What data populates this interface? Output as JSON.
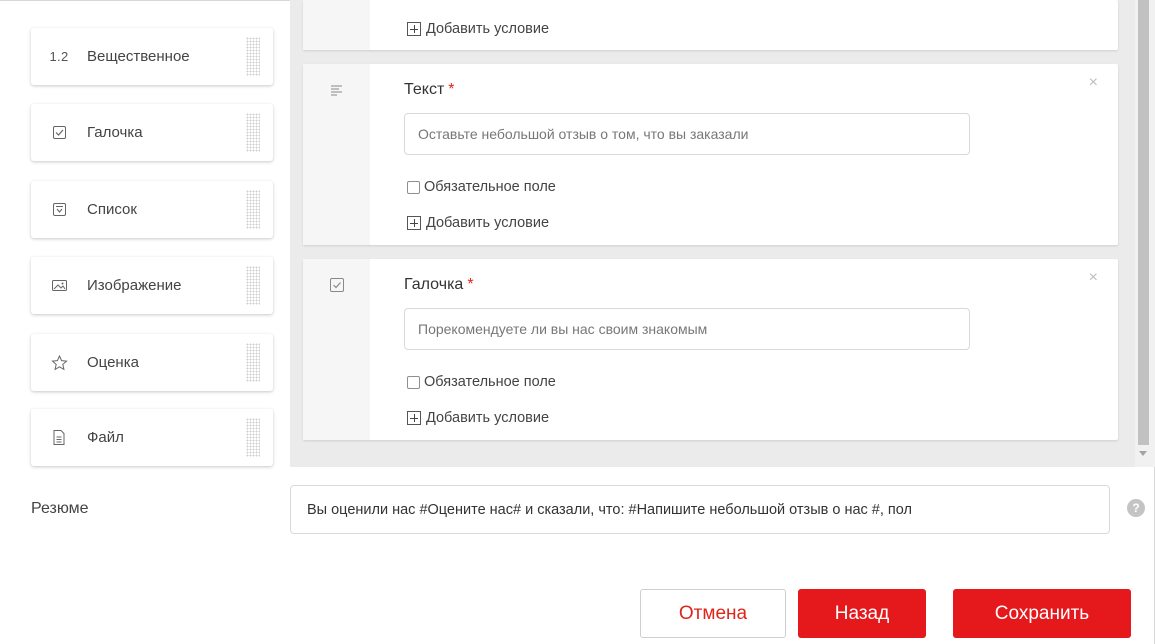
{
  "palette": {
    "items": [
      {
        "label": "Вещественное",
        "icon": "decimal-number-icon",
        "icon_text": "1.2"
      },
      {
        "label": "Галочка",
        "icon": "checkbox-icon"
      },
      {
        "label": "Список",
        "icon": "dropdown-list-icon"
      },
      {
        "label": "Изображение",
        "icon": "image-icon"
      },
      {
        "label": "Оценка",
        "icon": "star-icon"
      },
      {
        "label": "Файл",
        "icon": "file-icon"
      }
    ]
  },
  "form": {
    "previous_card": {
      "add_condition_label": "Добавить условие"
    },
    "cards": [
      {
        "icon": "text-lines-icon",
        "title": "Текст",
        "required_mark": "*",
        "input_placeholder": "Оставьте небольшой отзыв о том, что вы заказали",
        "required_checkbox_label": "Обязательное поле",
        "add_condition_label": "Добавить условие",
        "close_glyph": "×"
      },
      {
        "icon": "checkbox-icon",
        "title": "Галочка",
        "required_mark": "*",
        "input_placeholder": "Порекомендуете ли вы нас своим знакомым",
        "required_checkbox_label": "Обязательное поле",
        "add_condition_label": "Добавить условие",
        "close_glyph": "×"
      }
    ]
  },
  "summary": {
    "label": "Резюме",
    "value": "Вы оценили нас #Оцените нас# и сказали, что: #Напишите небольшой отзыв о нас #, пол",
    "help_glyph": "?"
  },
  "buttons": {
    "cancel": "Отмена",
    "back": "Назад",
    "save": "Сохранить"
  },
  "colors": {
    "accent_red": "#e5181c",
    "required_red": "#e0241a",
    "canvas_bg": "#ebebeb"
  }
}
